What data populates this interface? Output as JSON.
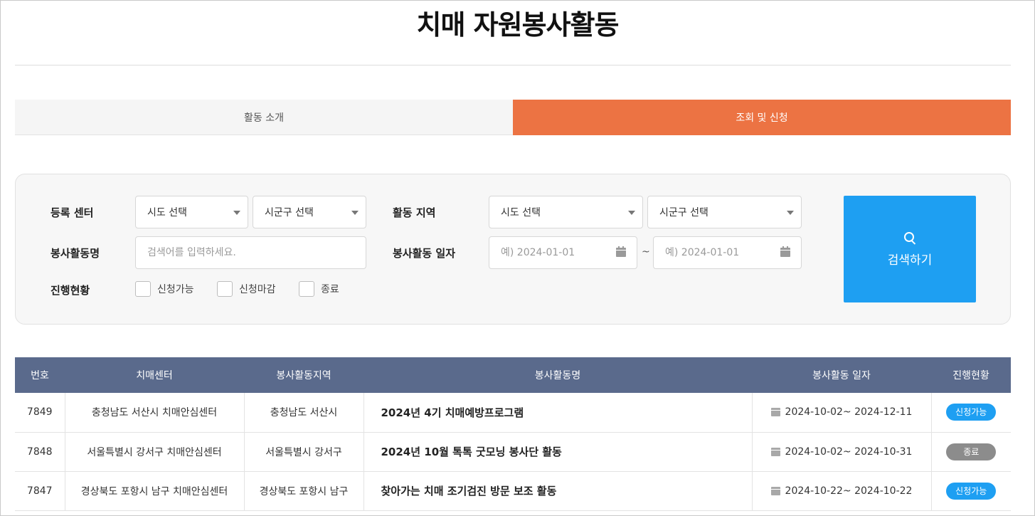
{
  "page": {
    "title": "치매 자원봉사활동"
  },
  "tabs": [
    {
      "label": "활동 소개",
      "active": false
    },
    {
      "label": "조회 및 신청",
      "active": true
    }
  ],
  "search": {
    "center_label": "등록 센터",
    "center_sido": "시도 선택",
    "center_sigungu": "시군구 선택",
    "region_label": "활동 지역",
    "region_sido": "시도 선택",
    "region_sigungu": "시군구 선택",
    "name_label": "봉사활동명",
    "name_placeholder": "검색어를 입력하세요.",
    "date_label": "봉사활동 일자",
    "date_from_placeholder": "예) 2024-01-01",
    "date_to_placeholder": "예) 2024-01-01",
    "date_separator": "~",
    "status_label": "진행현황",
    "status_options": [
      "신청가능",
      "신청마감",
      "종료"
    ],
    "button_label": "검색하기"
  },
  "table": {
    "headers": [
      "번호",
      "치매센터",
      "봉사활동지역",
      "봉사활동명",
      "봉사활동 일자",
      "진행현황"
    ],
    "rows": [
      {
        "no": "7849",
        "center": "충청남도 서산시 치매안심센터",
        "region": "충청남도 서산시",
        "name": "2024년 4기 치매예방프로그램",
        "date": "2024-10-02~ 2024-12-11",
        "status": "신청가능"
      },
      {
        "no": "7848",
        "center": "서울특별시 강서구 치매안심센터",
        "region": "서울특별시 강서구",
        "name": "2024년 10월 톡톡 굿모닝 봉사단 활동",
        "date": "2024-10-02~ 2024-10-31",
        "status": "종료"
      },
      {
        "no": "7847",
        "center": "경상북도 포항시 남구 치매안심센터",
        "region": "경상북도 포항시 남구",
        "name": "찾아가는 치매 조기검진 방문 보조 활동",
        "date": "2024-10-22~ 2024-10-22",
        "status": "신청가능"
      }
    ]
  },
  "colors": {
    "active_tab": "#ec7343",
    "header_bg": "#5a6a8c",
    "badge_open": "#1e9ff2",
    "badge_closed": "#8c8c8c",
    "search_button": "#1e9ff2"
  },
  "icons": {
    "search_button": "search-icon",
    "date_field": "calendar-icon",
    "dropdown": "chevron-down-icon"
  }
}
